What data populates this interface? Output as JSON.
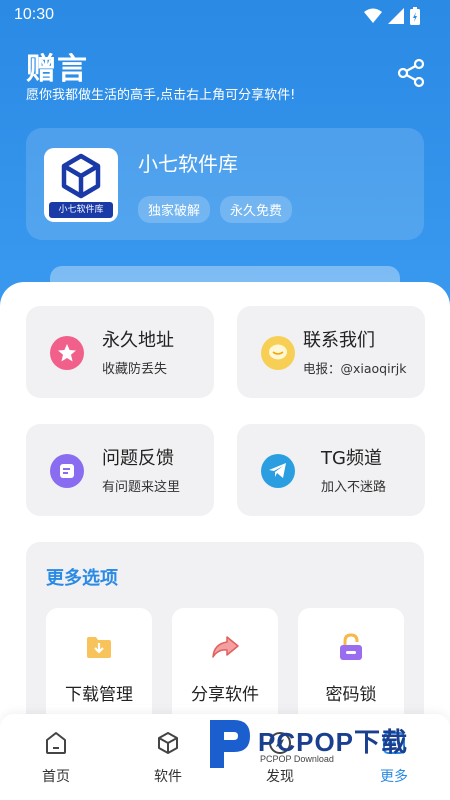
{
  "status_bar": {
    "time": "10:30"
  },
  "header": {
    "title": "赠言",
    "subtitle": "愿你我都做生活的高手,点击右上角可分享软件!"
  },
  "app": {
    "name": "小七软件库",
    "logo_text": "小七软件库",
    "tags": [
      "独家破解",
      "永久免费"
    ]
  },
  "cards": [
    {
      "title": "永久地址",
      "desc": "收藏防丢失",
      "icon": "star-icon",
      "color": "#f0608a"
    },
    {
      "title": "联系我们",
      "desc": "电报：@xiaoqirjk",
      "icon": "chat-bubble-icon",
      "color": "#f5c542"
    },
    {
      "title": "问题反馈",
      "desc": "有问题来这里",
      "icon": "feedback-icon",
      "color": "#8a6cf0"
    },
    {
      "title": "TG频道",
      "desc": "加入不迷路",
      "icon": "telegram-icon",
      "color": "#2a9ee0"
    }
  ],
  "more": {
    "title": "更多选项",
    "options": [
      {
        "label": "下载管理",
        "icon": "download-folder-icon",
        "color": "#f5b335"
      },
      {
        "label": "分享软件",
        "icon": "share-arrow-icon",
        "color": "#f07a7a"
      },
      {
        "label": "密码锁",
        "icon": "lock-icon",
        "color": "#9a6cf0"
      }
    ]
  },
  "nav": {
    "items": [
      {
        "label": "首页",
        "icon": "home-icon"
      },
      {
        "label": "软件",
        "icon": "cube-icon"
      },
      {
        "label": "发现",
        "icon": "discover-icon"
      },
      {
        "label": "更多",
        "icon": "more-icon"
      }
    ],
    "active": "更多"
  },
  "watermark": {
    "text": "PCPOP下载",
    "sub": "PCPOP Download"
  },
  "colors": {
    "primary": "#2a8ae4",
    "card_bg": "#f1f1f3"
  }
}
